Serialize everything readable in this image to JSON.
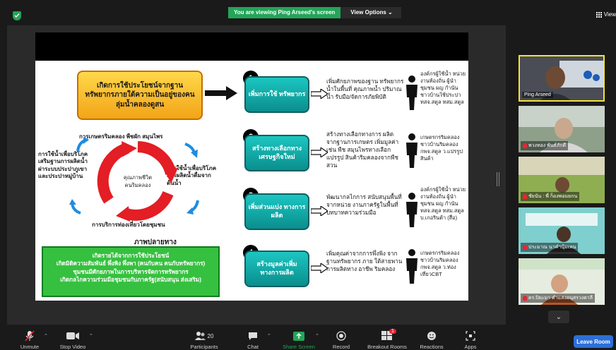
{
  "banner": {
    "viewing": "You are viewing Ping Arseed's screen",
    "options": "View Options ⌄"
  },
  "top_right": {
    "view": "View"
  },
  "slide": {
    "main_goal": "เกิดการใช้ประโยชน์จากฐานทรัพยากรภายใต้ความเป็นอยู่ของคนลุ่มน้ำคลองดูสน",
    "cycle": {
      "top": "การเกษตรริมคลอง พืชผัก สมุนไพร",
      "left": "การใช้น้ำเพื่อบริโภค เสริมฐานการผลิตน้ำ ผ่าระบบประปาภูเขา และประปาหมู่บ้าน",
      "right": "การใช้น้ำเพื่อบริโภค การผลิตน้ำดื่มจาก ต้นน้ำ",
      "center": "คุณภาพชีวิต คนริมคลอง",
      "bottom": "การบริการท่องเที่ยวโดยชุมชน"
    },
    "future_label": "ภาพปลายทาง",
    "future_lines": [
      "เกิดรายได้จากการใช้ประโยชน์",
      "เกิดมิติความสัมพันธ์ พึ่งพิง พึ่งพา (คนกับคน คนกับทรัพยากร)",
      "ชุมชนมีศักยภาพในการบริหารจัดการทรัพยากร",
      "เกิดกลไกความร่วมมือชุมชนกับภาครัฐ(สนับสนุน ส่งเสริม)"
    ],
    "steps": [
      {
        "num": "1",
        "title": "เพิ่มการใช้ ทรัพยากร",
        "desc": "เพิ่มศักยภาพของฐาน ทรัพยากรน้ำในพื้นที่ คุณภาพน้ำ ปริมาณน้ำ รับมือ/จัดการภัยพิบัติ",
        "org": "องค์กรผู้ใช้น้ำ หน่วยงานท้องถิ่น ผู้นำชุมชน ผญ กำนัน ชาวบ้านใช้ประปา ทสจ.สตูล ทสม.สตูล"
      },
      {
        "num": "2",
        "title": "สร้างทางเลือกทาง เศรษฐกิจใหม่",
        "desc": "สร้างทางเลือกทางการ ผลิต จากฐานการเกษตร เพิ่มมูลค่า เช่น พืช สมุนไพรทางเลือก แปรรูป สินค้าริมคลองจากพืช สวน",
        "org": "เกษตรกรริมคลอง ชาวบ้านริมคลอง กพจ.สตูล ว.แปรรูปสินค้า"
      },
      {
        "num": "3",
        "title": "เพิ่มส่วนแบ่ง ทางการผลิต",
        "desc": "พัฒนากลไกการ สนับสนุนพื้นที่ จากหน่วย งานภาครัฐในพื้นที่ บทบาทความร่วมมือ",
        "org": "องค์กรผู้ใช้น้ำ หน่วยงานท้องถิ่น ผู้นำชุมชน ผญ กำนัน ทสจ.สตูล ทสม.สตูล บ.เกอรินต้า (สื่อ)"
      },
      {
        "num": "4",
        "title": "สร้างมูลค่าเพิ่ม ทางการผลิต",
        "desc": "เพิ่มคุณค่าจากการพึ่งพิง จากฐานทรัพยากร ภาย ใต้สายพานการผลิตทาง อาชีพ ริมคลอง",
        "org": "เกษตรกรริมคลอง ชาวบ้านริมคลอง กพจ.สตูล ว.ท่องเที่ยวCBT"
      }
    ]
  },
  "participants": [
    {
      "name": "Ping Arseed",
      "muted": false,
      "active": true
    },
    {
      "name": "พวงทอง พันธ์ภักดี",
      "muted": true,
      "active": false
    },
    {
      "name": "ชัยนัน : พี่ ก็องพอมยกน",
      "muted": true,
      "active": false
    },
    {
      "name": "ประมาณ นาคำนุ้มเหน",
      "muted": true,
      "active": false
    },
    {
      "name": "ดร.ปิยะมา คำแสงอนุสรวงตาลี",
      "muted": true,
      "active": false
    }
  ],
  "toolbar": {
    "unmute": "Unmute",
    "stop_video": "Stop Video",
    "participants": "Participants",
    "participants_count": "20",
    "chat": "Chat",
    "share_screen": "Share Screen",
    "record": "Record",
    "breakout": "Breakout Rooms",
    "breakout_badge": "1",
    "reactions": "Reactions",
    "apps": "Apps",
    "leave": "Leave Room"
  },
  "colors": {
    "share_green": "#23a559",
    "leave_blue": "#2d6fd8",
    "teal": "#0a8e8d",
    "orange": "#f3a418",
    "green_box": "#36c03f"
  }
}
